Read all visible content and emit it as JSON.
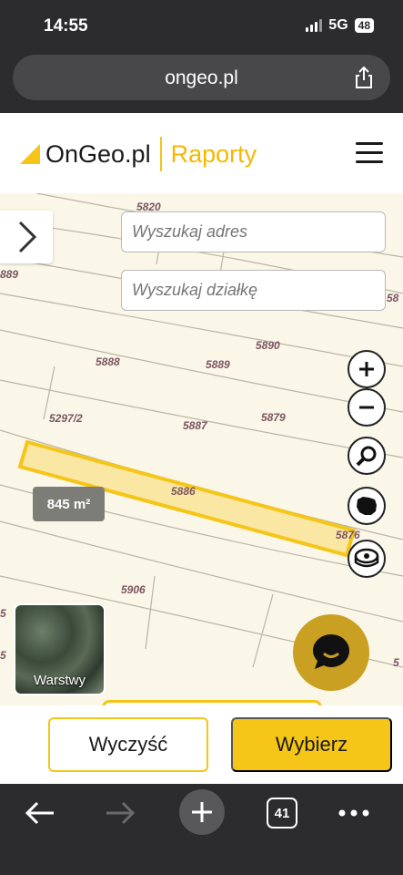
{
  "status_bar": {
    "time": "14:55",
    "network": "5G",
    "battery": "48"
  },
  "browser": {
    "url": "ongeo.pl"
  },
  "site": {
    "logo_text": "OnGeo.pl",
    "logo_sub": "Raporty"
  },
  "map": {
    "search_address_placeholder": "Wyszukaj adres",
    "search_plot_placeholder": "Wyszukaj działkę",
    "area": "845 m²",
    "layers_label": "Warstwy",
    "plot_numbers": {
      "p5820": "5820",
      "p889": "889",
      "p5890": "5890",
      "p5888": "5888",
      "p5889": "5889",
      "p5297_2": "5297/2",
      "p5887": "5887",
      "p5879": "5879",
      "p5886": "5886",
      "p5876": "5876",
      "p5906": "5906",
      "p58": "58",
      "p5a": "5",
      "p5b": "5",
      "p5c": "5"
    }
  },
  "actions": {
    "clear": "Wyczyść",
    "choose": "Wybierz"
  },
  "browser_toolbar": {
    "tabs_count": "41"
  },
  "colors": {
    "accent": "#f5c518",
    "map_bg": "#faf6e8",
    "chrome": "#2c2c2e"
  }
}
